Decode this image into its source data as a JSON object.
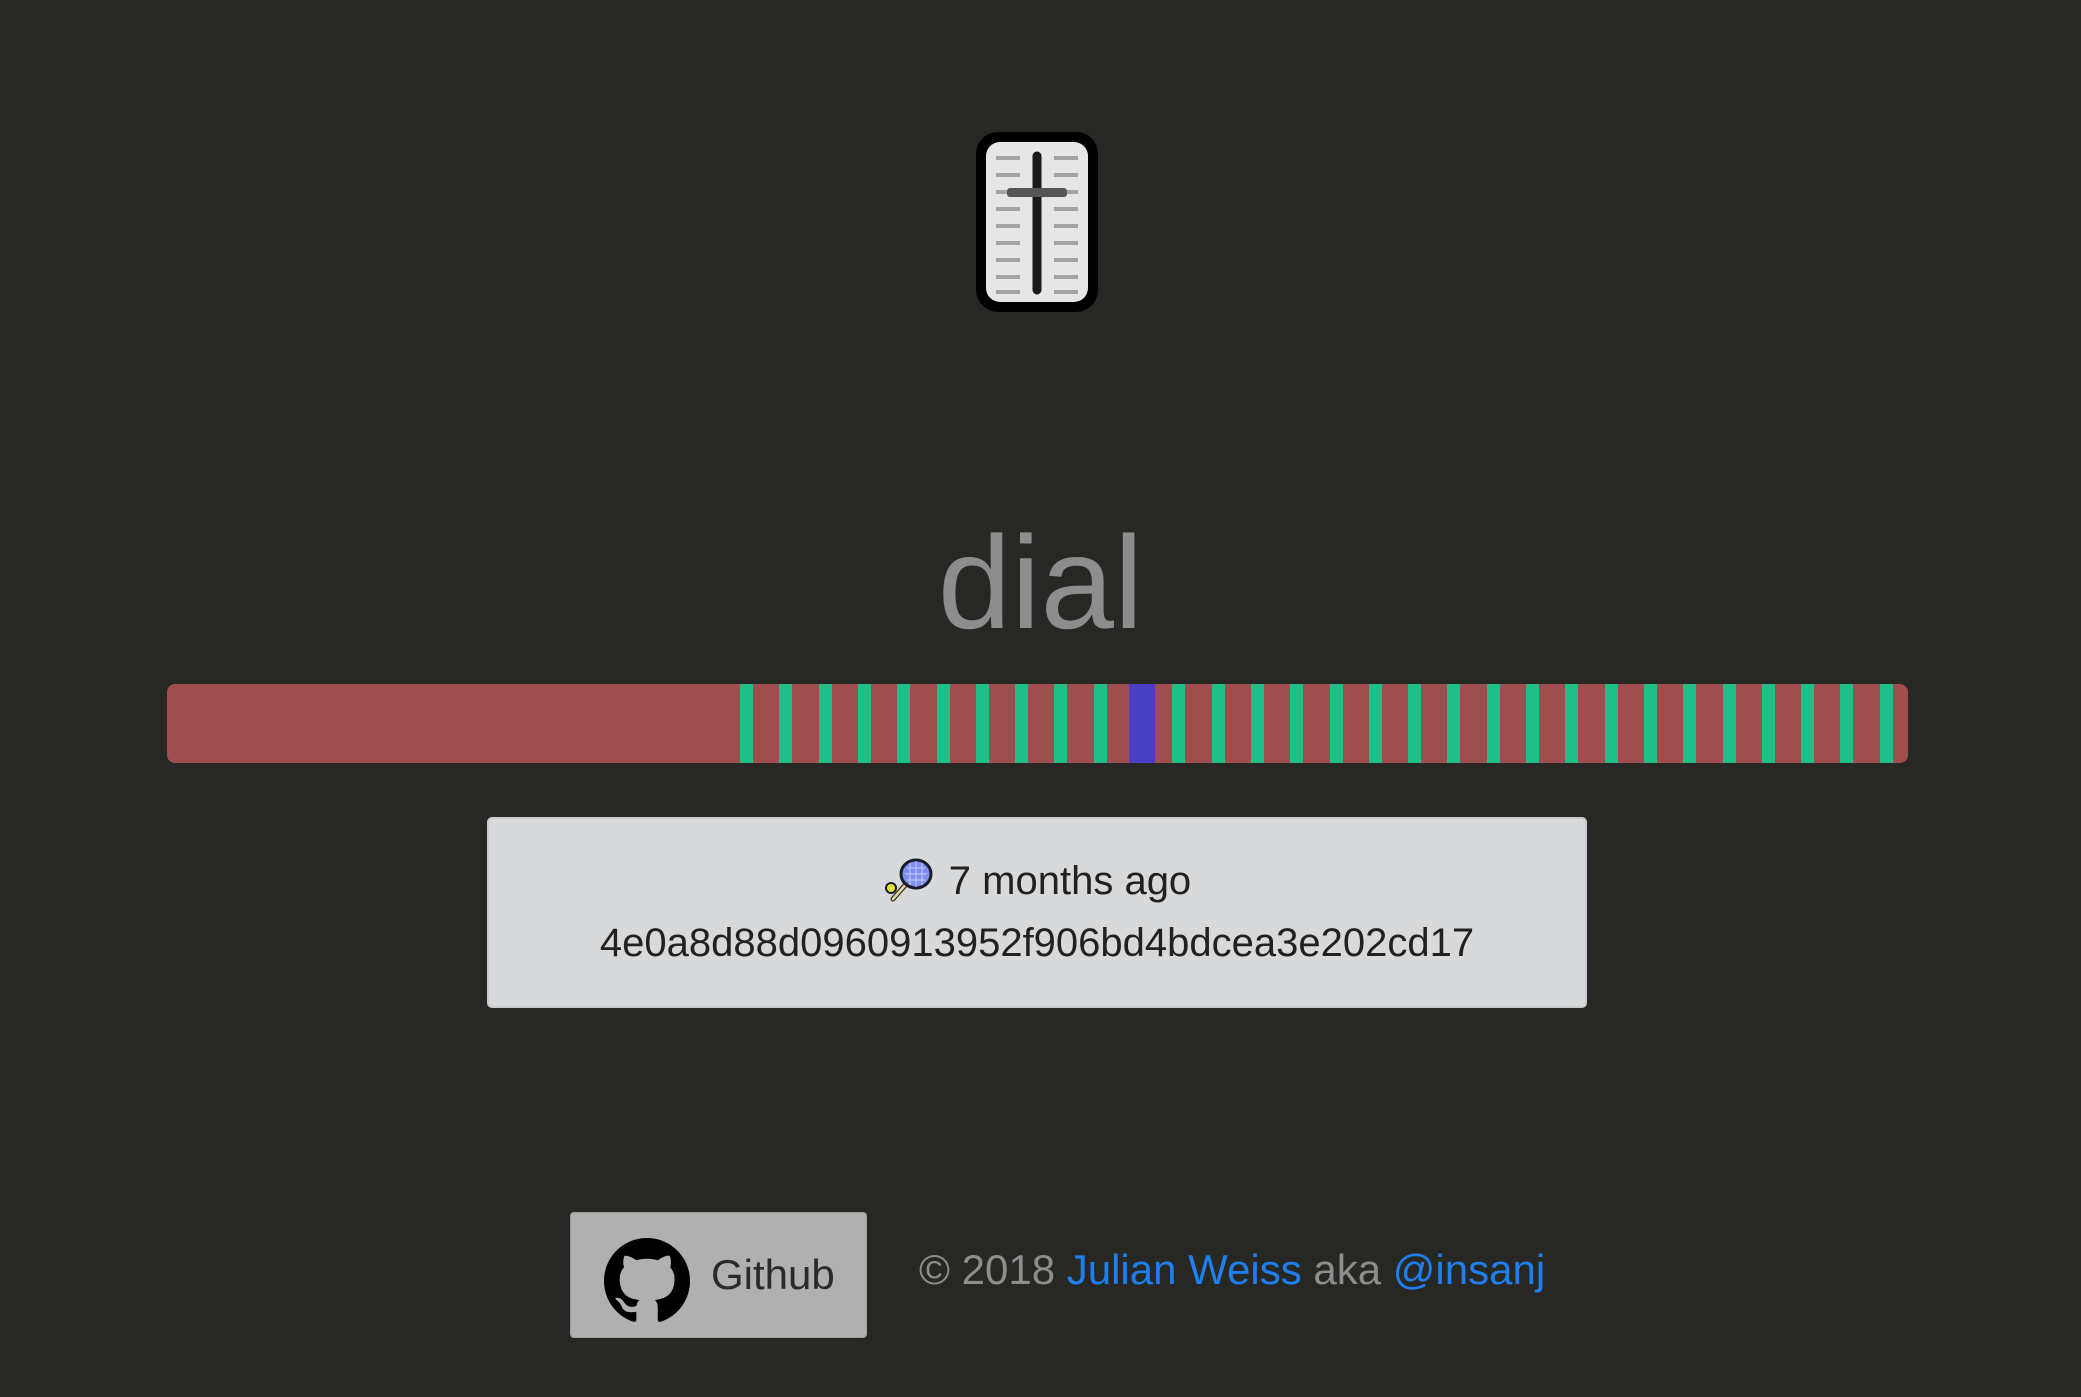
{
  "app": {
    "title": "dial"
  },
  "timeline": {
    "colors": {
      "track": "#9e4e4e",
      "tick": "#1ebf88",
      "current": "#4a3fc6"
    },
    "tick_count": 30,
    "current_index": 10
  },
  "info": {
    "icon": "tennis-racket-icon",
    "relative_time": "7 months ago",
    "commit_hash": "4e0a8d88d0960913952f906bd4bdcea3e202cd17"
  },
  "footer": {
    "github_label": "Github",
    "copyright": "© 2018",
    "author_name": "Julian Weiss",
    "aka": "aka",
    "handle": "@insanj",
    "link_color": "#1f7ff0"
  }
}
